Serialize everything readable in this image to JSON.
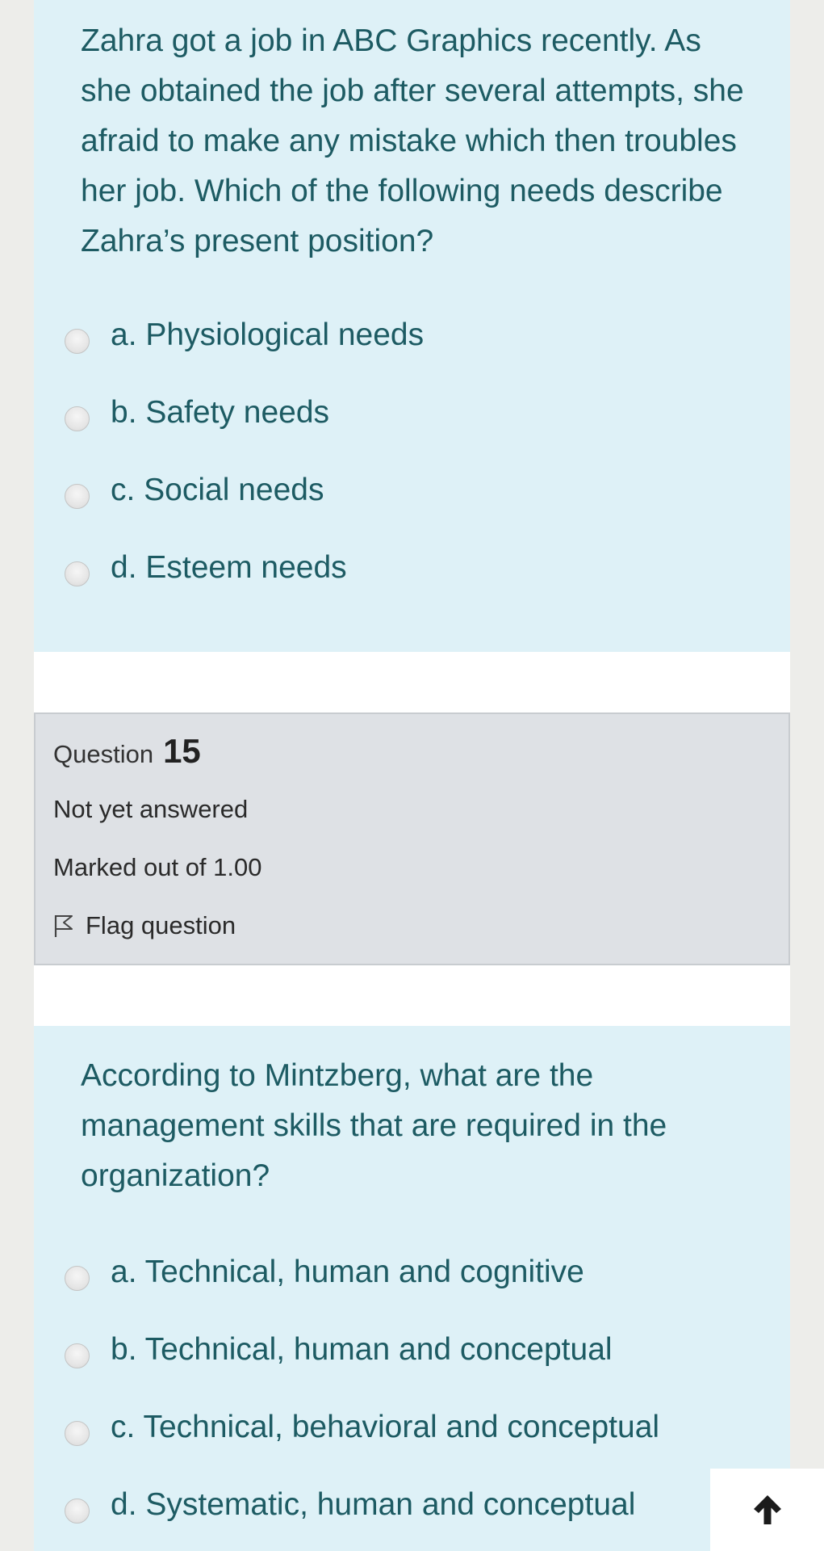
{
  "question_prev": {
    "text": "Zahra got a job in ABC Graphics recently. As she obtained the job after several attempts, she afraid to make any mistake which then troubles her job. Which of the following needs describe Zahra’s present position?",
    "answers": [
      {
        "label": "a. Physiological needs"
      },
      {
        "label": "b. Safety needs"
      },
      {
        "label": "c. Social needs"
      },
      {
        "label": "d. Esteem needs"
      }
    ]
  },
  "question_info": {
    "question_word": "Question",
    "question_number": "15",
    "state": "Not yet answered",
    "grade": "Marked out of 1.00",
    "flag_label": "Flag question",
    "flag_icon": "flag-icon"
  },
  "question_current": {
    "text": "According to Mintzberg,  what are the management skills that are required in the organization?",
    "answers": [
      {
        "label": "a. Technical, human and cognitive"
      },
      {
        "label": "b. Technical, human and conceptual"
      },
      {
        "label": "c. Technical, behavioral and conceptual"
      },
      {
        "label": "d. Systematic, human and conceptual"
      }
    ]
  },
  "scroll_top": {
    "icon": "arrow-up-icon"
  },
  "colors": {
    "question_background": "#def1f7",
    "question_text": "#1d5b63",
    "info_background": "#dee1e5"
  }
}
